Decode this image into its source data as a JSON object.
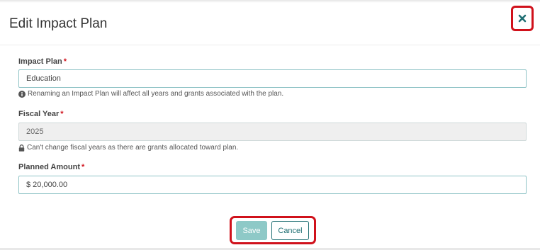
{
  "modal": {
    "title": "Edit Impact Plan",
    "close_icon": "close-x-icon"
  },
  "fields": {
    "impact_plan": {
      "label": "Impact Plan",
      "required_mark": "*",
      "value": "Education",
      "help_icon": "info-circle-icon",
      "help_text": "Renaming an Impact Plan will affect all years and grants associated with the plan."
    },
    "fiscal_year": {
      "label": "Fiscal Year",
      "required_mark": "*",
      "value": "2025",
      "help_icon": "lock-icon",
      "help_text": "Can't change fiscal years as there are grants allocated toward plan."
    },
    "planned_amount": {
      "label": "Planned Amount",
      "required_mark": "*",
      "value": "$ 20,000.00"
    }
  },
  "footer": {
    "save_label": "Save",
    "cancel_label": "Cancel"
  },
  "colors": {
    "accent": "#1f6f73",
    "save_bg": "#8ec9c7",
    "required": "#d0111b",
    "highlight": "#d0111b"
  }
}
